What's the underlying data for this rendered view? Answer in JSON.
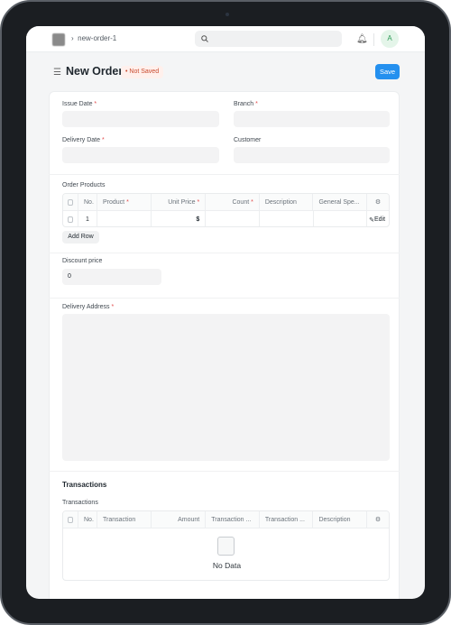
{
  "navbar": {
    "breadcrumb": "new-order-1",
    "avatar_initial": "A"
  },
  "header": {
    "title": "New Order",
    "status": "Not Saved",
    "save_label": "Save"
  },
  "fields": {
    "issue_date": "Issue Date",
    "branch": "Branch",
    "delivery_date": "Delivery Date",
    "customer": "Customer",
    "discount_label": "Discount price",
    "discount_value": "0",
    "delivery_address": "Delivery Address",
    "required_mark": "*"
  },
  "order_products": {
    "label": "Order Products",
    "columns": [
      "No.",
      "Product",
      "Unit Price",
      "Count",
      "Description",
      "General Spe..."
    ],
    "rows": [
      {
        "no": "1",
        "unit_price": "$",
        "edit": "Edit"
      }
    ],
    "add_row": "Add Row"
  },
  "transactions": {
    "section_title": "Transactions",
    "label": "Transactions",
    "columns": [
      "No.",
      "Transaction",
      "Amount",
      "Transaction ...",
      "Transaction ...",
      "Description"
    ],
    "empty": "No Data"
  },
  "colors": {
    "accent": "#2490ef",
    "status": "#c9492d",
    "required": "#e24c4c"
  }
}
